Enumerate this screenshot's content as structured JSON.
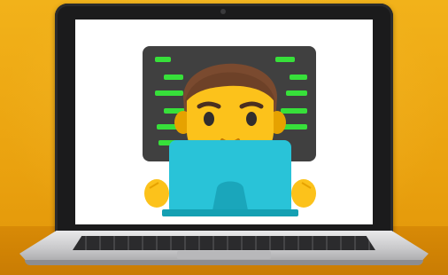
{
  "scene": {
    "background_color": "#eea812",
    "device": "laptop",
    "screen_content": "man-technologist-emoji",
    "screen_background": "#ffffff"
  }
}
